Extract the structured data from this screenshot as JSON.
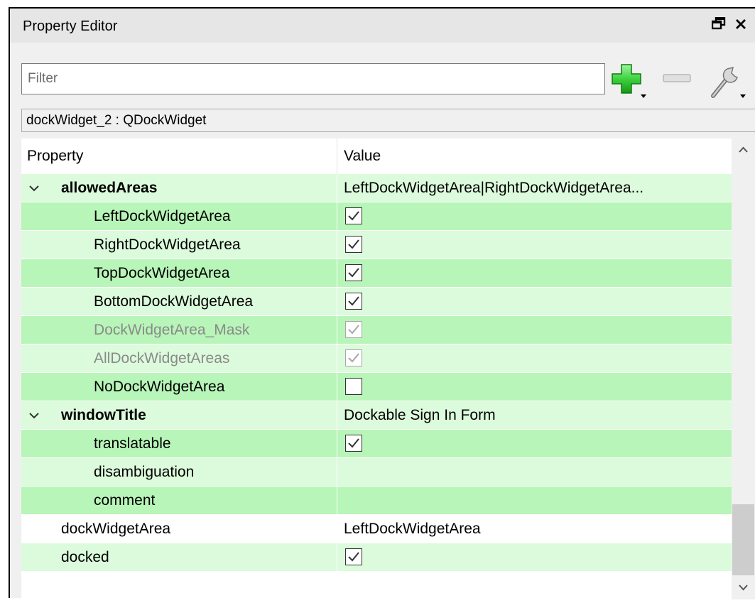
{
  "panel": {
    "title": "Property Editor",
    "float_button": "🗗",
    "close_button": "✕"
  },
  "toolbar": {
    "filter_placeholder": "Filter",
    "filter_value": "",
    "add_icon": "plus-icon",
    "remove_icon": "minus-icon",
    "configure_icon": "wrench-icon"
  },
  "object_label": "dockWidget_2 : QDockWidget",
  "table": {
    "headers": [
      "Property",
      "Value"
    ],
    "rows": [
      {
        "name": "allowedAreas",
        "value": "LeftDockWidgetArea|RightDockWidgetArea...",
        "checked": null
      },
      {
        "name": "LeftDockWidgetArea",
        "value": "",
        "checked": true
      },
      {
        "name": "RightDockWidgetArea",
        "value": "",
        "checked": true
      },
      {
        "name": "TopDockWidgetArea",
        "value": "",
        "checked": true
      },
      {
        "name": "BottomDockWidgetArea",
        "value": "",
        "checked": true
      },
      {
        "name": "DockWidgetArea_Mask",
        "value": "",
        "checked": true
      },
      {
        "name": "AllDockWidgetAreas",
        "value": "",
        "checked": true
      },
      {
        "name": "NoDockWidgetArea",
        "value": "",
        "checked": false
      },
      {
        "name": "windowTitle",
        "value": "Dockable Sign In Form",
        "checked": null
      },
      {
        "name": "translatable",
        "value": "",
        "checked": true
      },
      {
        "name": "disambiguation",
        "value": "",
        "checked": null
      },
      {
        "name": "comment",
        "value": "",
        "checked": null
      },
      {
        "name": "dockWidgetArea",
        "value": "LeftDockWidgetArea",
        "checked": null
      },
      {
        "name": "docked",
        "value": "",
        "checked": true
      }
    ]
  },
  "colors": {
    "row_dark": "#b8f5b8",
    "row_light": "#dcfadc",
    "add_green": "#2fbf2f"
  }
}
